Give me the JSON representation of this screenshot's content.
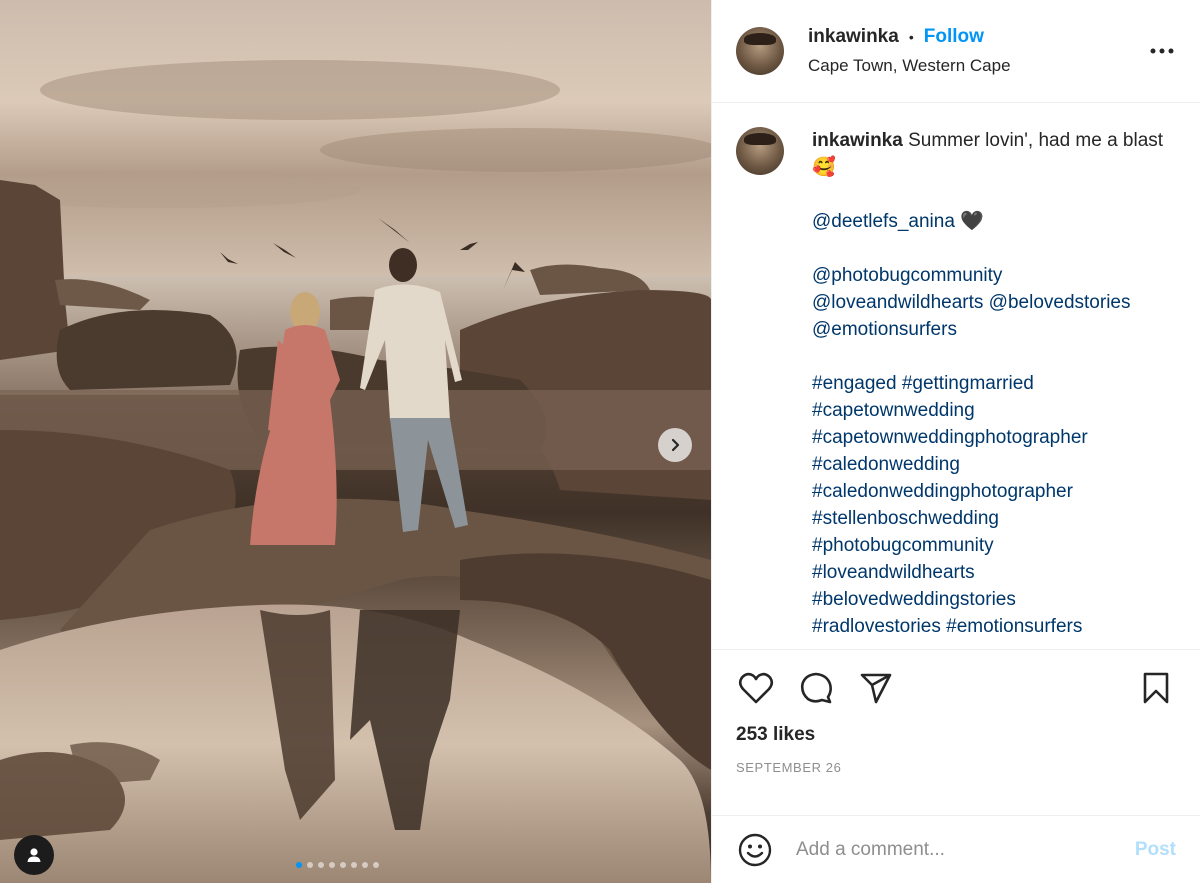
{
  "header": {
    "username": "inkawinka",
    "separator": "•",
    "follow_label": "Follow",
    "location": "Cape Town, Western Cape",
    "more_icon": "more-horizontal-icon"
  },
  "caption": {
    "username": "inkawinka",
    "text": "Summer lovin', had me a blast",
    "emoji": "🥰",
    "mention_main": "@deetlefs_anina",
    "heart": "🖤",
    "mentions": [
      "@photobugcommunity",
      "@loveandwildhearts",
      "@belovedstories",
      "@emotionsurfers"
    ],
    "hashtags_line1": [
      "#engaged",
      "#gettingmarried"
    ],
    "hashtags": [
      "#capetownwedding",
      "#capetownweddingphotographer",
      "#caledonwedding",
      "#caledonweddingphotographer",
      "#stellenboschwedding",
      "#photobugcommunity",
      "#loveandwildhearts",
      "#belovedweddingstories"
    ],
    "hashtags_last": [
      "#radlovestories",
      "#emotionsurfers"
    ]
  },
  "actions": {
    "like_icon": "heart-icon",
    "comment_icon": "comment-icon",
    "share_icon": "share-icon",
    "save_icon": "bookmark-icon"
  },
  "likes": "253 likes",
  "date": "SEPTEMBER 26",
  "comment_box": {
    "placeholder": "Add a comment...",
    "post_label": "Post",
    "emoji_icon": "smiley-icon"
  },
  "media": {
    "slide_count": 8,
    "active_slide": 1,
    "next_icon": "chevron-right-icon",
    "tag_icon": "user-tag-icon"
  },
  "colors": {
    "accent": "#0095f6",
    "link": "#00376b",
    "post_disabled": "#b2dffc",
    "muted": "#8e8e8e"
  }
}
